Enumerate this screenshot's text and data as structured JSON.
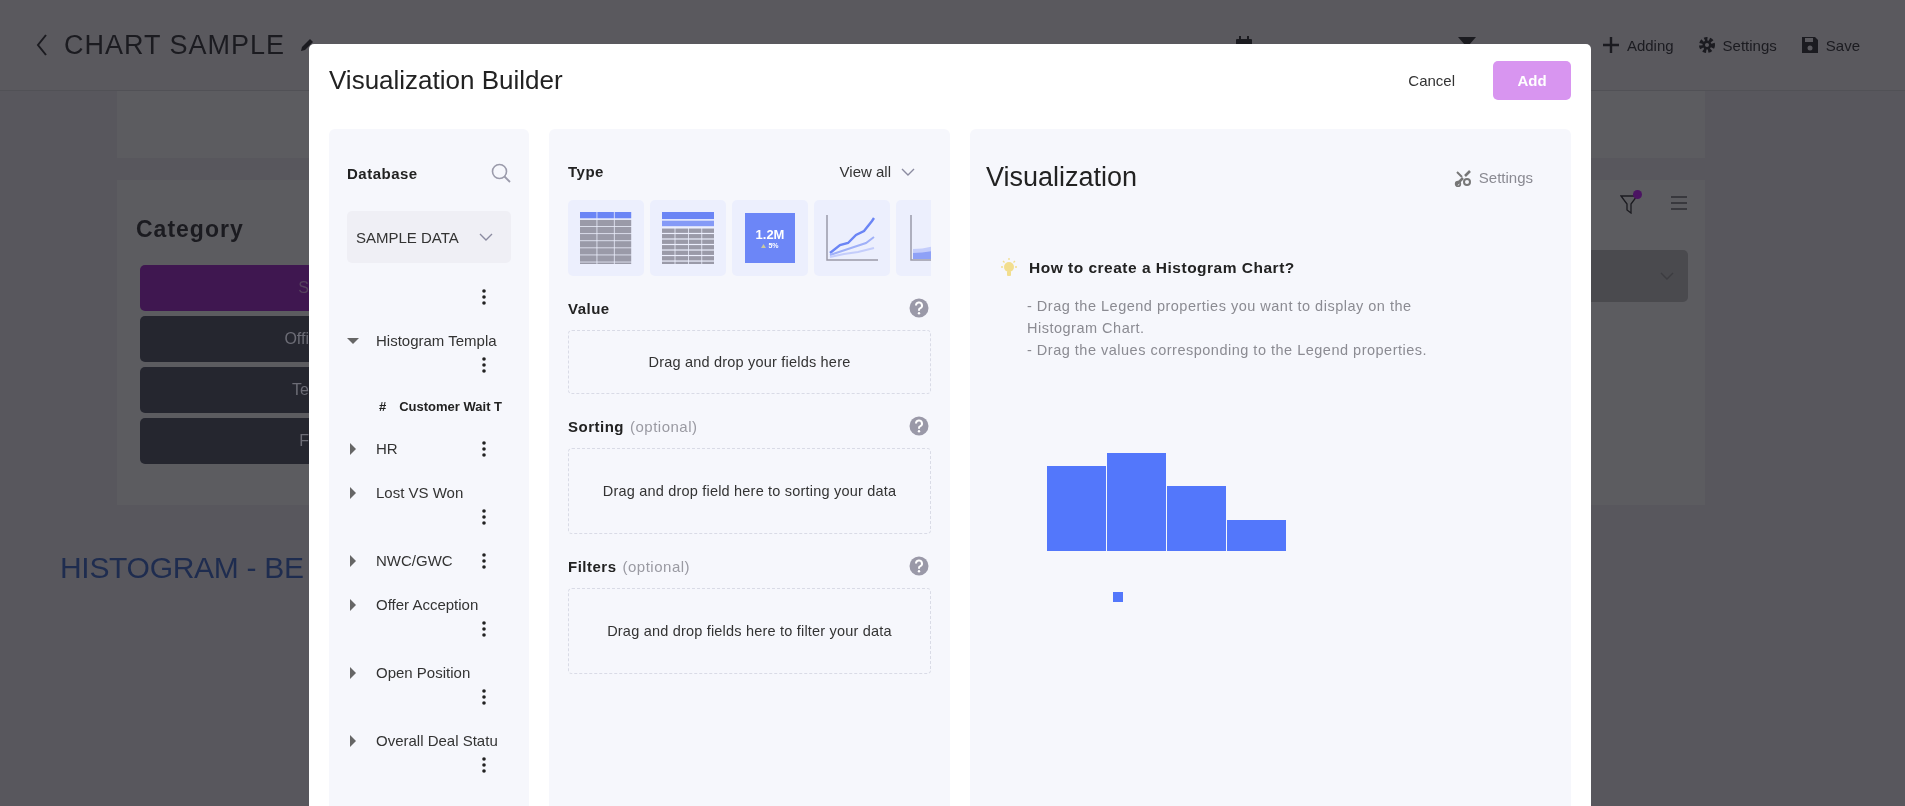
{
  "page": {
    "title": "CHART SAMPLE",
    "toolbar": [
      {
        "kind": "date"
      },
      {
        "kind": "filter"
      },
      {
        "kind": "add",
        "label": "Adding"
      },
      {
        "kind": "settings",
        "label": "Settings"
      },
      {
        "kind": "save",
        "label": "Save"
      }
    ]
  },
  "category_card": {
    "title": "Category",
    "filter_active": true,
    "options": [
      {
        "label": "S",
        "selected": true
      },
      {
        "label": "Offi",
        "selected": false
      },
      {
        "label": "Te",
        "selected": false
      },
      {
        "label": "F",
        "selected": false
      }
    ]
  },
  "section_title": "HISTOGRAM - BE",
  "dialog": {
    "title": "Visualization Builder",
    "buttons": [
      {
        "kind": "text",
        "label": "Cancel"
      },
      {
        "kind": "primary",
        "label": "Add"
      }
    ],
    "database": {
      "title": "Database",
      "source": "SAMPLE DATA",
      "tree": [
        {
          "kind": "blank"
        },
        {
          "kind": "folder",
          "label": "Histogram Templa",
          "expanded": true,
          "children": [
            {
              "kind": "field",
              "type_symbol": "#",
              "label": "Customer Wait T"
            }
          ]
        },
        {
          "kind": "folder",
          "label": "HR",
          "expanded": false
        },
        {
          "kind": "folder",
          "label": "Lost VS Won",
          "expanded": false
        },
        {
          "kind": "folder",
          "label": "NWC/GWC",
          "expanded": false
        },
        {
          "kind": "folder",
          "label": "Offer Acception",
          "expanded": false
        },
        {
          "kind": "folder",
          "label": "Open Position",
          "expanded": false
        },
        {
          "kind": "folder",
          "label": "Overall Deal Statu",
          "expanded": false
        }
      ]
    },
    "builder": {
      "type_label": "Type",
      "view_all": "View all",
      "chart_types": [
        {
          "kind": "table"
        },
        {
          "kind": "pivot"
        },
        {
          "kind": "kpi",
          "value": "1.2M",
          "delta": "5%"
        },
        {
          "kind": "line"
        },
        {
          "kind": "area"
        }
      ],
      "sections": [
        {
          "title": "Value",
          "hint": "Drag and drop your fields here"
        },
        {
          "title": "Sorting",
          "note": "(optional)",
          "hint": "Drag and drop field here to sorting your data"
        },
        {
          "title": "Filters",
          "note": "(optional)",
          "hint": "Drag and drop fields here to filter your data"
        }
      ]
    },
    "visualization": {
      "title": "Visualization",
      "settings": "Settings",
      "help_title": "How to create a Histogram Chart?",
      "help_lines": [
        "- Drag the Legend properties you want to display on the Histogram Chart.",
        "- Drag the values corresponding to the Legend properties."
      ]
    }
  }
}
